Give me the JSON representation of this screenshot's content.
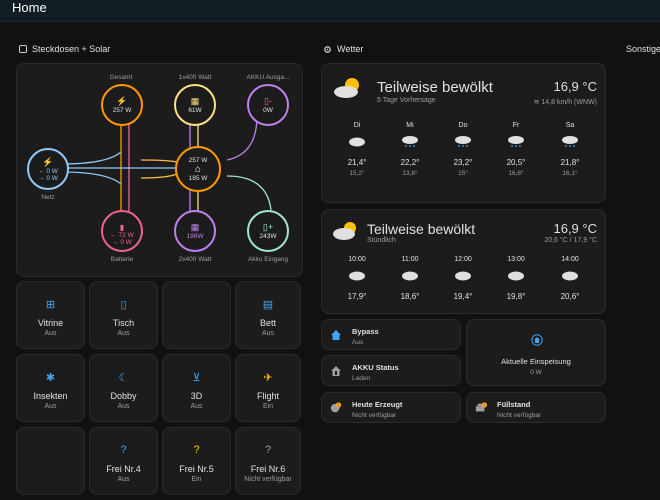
{
  "header": {
    "title": "Home"
  },
  "sections": {
    "energy": "Steckdosen + Solar",
    "weather": "Wetter",
    "other": "Sonstige"
  },
  "energy": {
    "gesamt": {
      "label": "Gesamt",
      "value": "257 W"
    },
    "solar1": {
      "label": "1x400 Watt",
      "value": "61W"
    },
    "akku_out": {
      "label": "AKKU Ausga...",
      "value": "0W"
    },
    "netz": {
      "label": "Netz",
      "in": "← 0 W",
      "out": "→ 0 W"
    },
    "home": {
      "top": "257 W",
      "bottom": "185 W"
    },
    "batterie": {
      "label": "Batterie",
      "pct": "72 %",
      "in": "← 72 W",
      "out": "→ 0 W"
    },
    "solar2": {
      "label": "2x400 Watt",
      "value": "196W"
    },
    "akku_in": {
      "label": "Akku Eingang",
      "value": "243W"
    }
  },
  "tiles": [
    {
      "name": "Vitrine",
      "state": "Aus",
      "icon": "window-icon"
    },
    {
      "name": "Tisch",
      "state": "Aus",
      "icon": "phone-icon"
    },
    {
      "name": "",
      "state": "",
      "icon": ""
    },
    {
      "name": "Bett",
      "state": "Aus",
      "icon": "bed-icon"
    },
    {
      "name": "Insekten",
      "state": "Aus",
      "icon": "bug-icon"
    },
    {
      "name": "Dobby",
      "state": "Aus",
      "icon": "moon-icon"
    },
    {
      "name": "3D",
      "state": "Aus",
      "icon": "printer-3d-icon"
    },
    {
      "name": "Flight",
      "state": "Ein",
      "icon": "airplane-icon"
    },
    {
      "name": "",
      "state": "",
      "icon": ""
    },
    {
      "name": "Frei Nr.4",
      "state": "Aus",
      "icon": "question-icon"
    },
    {
      "name": "Frei Nr.5",
      "state": "Ein",
      "icon": "question-icon"
    },
    {
      "name": "Frei Nr.6",
      "state": "Nicht verfügbar",
      "icon": "question-icon"
    }
  ],
  "weather1": {
    "condition": "Teilweise bewölkt",
    "sub": "5 Tage Vorhersage",
    "temp": "16,9 °C",
    "wind": "14,8 km/h (WNW)",
    "days": [
      {
        "d": "Di",
        "hi": "21,4°",
        "lo": "15,2°"
      },
      {
        "d": "Mi",
        "hi": "22,2°",
        "lo": "13,8°"
      },
      {
        "d": "Do",
        "hi": "23,2°",
        "lo": "15°"
      },
      {
        "d": "Fr",
        "hi": "20,5°",
        "lo": "16,8°"
      },
      {
        "d": "Sa",
        "hi": "21,8°",
        "lo": "16,1°"
      }
    ]
  },
  "weather2": {
    "condition": "Teilweise bewölkt",
    "sub": "Stündlich",
    "temp": "16,9 °C",
    "range": "20,6 °C / 17,9 °C",
    "hours": [
      {
        "d": "10:00",
        "hi": "17,9°"
      },
      {
        "d": "11:00",
        "hi": "18,6°"
      },
      {
        "d": "12:00",
        "hi": "19,4°"
      },
      {
        "d": "13:00",
        "hi": "19,8°"
      },
      {
        "d": "14:00",
        "hi": "20,6°"
      }
    ]
  },
  "status": {
    "bypass": {
      "name": "Bypass",
      "state": "Aus"
    },
    "akku": {
      "name": "AKKU Status",
      "state": "Laden"
    },
    "heute": {
      "name": "Heute Erzeugt",
      "state": "Nicht verfügbar"
    },
    "einspeisung": {
      "name": "Aktuelle Einspeisung",
      "state": "0 W"
    },
    "fuell": {
      "name": "Füllstand",
      "state": "Nicht verfügbar"
    }
  },
  "colors": {
    "accent": "#ff9800",
    "solar": "#ffe082",
    "battery": "#f06292",
    "akku_out": "#c080f0",
    "grid": "#90caf9",
    "akku_in": "#a0e6d0",
    "blue": "#42a5f5"
  }
}
